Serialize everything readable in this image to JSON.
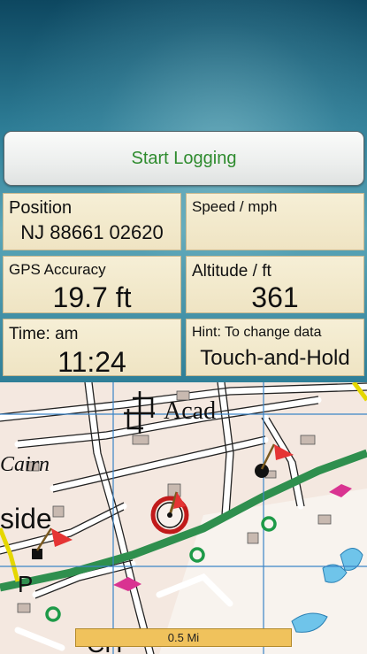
{
  "button": {
    "start_logging": "Start Logging"
  },
  "tiles": {
    "position": {
      "label": "Position",
      "value": "NJ 88661 02620"
    },
    "speed": {
      "label": "Speed / mph",
      "value": ""
    },
    "accuracy": {
      "label": "GPS Accuracy",
      "value": "19.7 ft"
    },
    "altitude": {
      "label": "Altitude / ft",
      "value": "361"
    },
    "time": {
      "label": "Time: am",
      "value": "11:24"
    },
    "hint": {
      "label": "Hint: To change data",
      "value": "Touch-and-Hold"
    }
  },
  "map": {
    "labels": {
      "acad": "Acad",
      "cairn": "Cairn",
      "side": "side",
      "p": "P",
      "ch": "CH"
    },
    "scale_label": "0.5 Mi"
  },
  "colors": {
    "button_text": "#2e8b2e",
    "tile_bg": "#f6efd6",
    "road_green": "#2f8f4e",
    "grid_line": "#3b84c7",
    "scale_bg": "#f0c25c"
  },
  "icons": {
    "location_marker": "location-marker-icon",
    "waypoint_flag": "flag-icon",
    "waypoint_pink": "pink-marker-icon",
    "poi_circle": "green-circle-icon",
    "church": "church-icon"
  }
}
